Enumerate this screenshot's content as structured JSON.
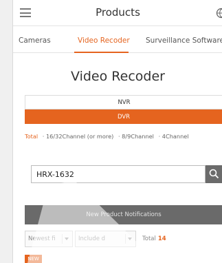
{
  "header": {
    "title": "Products",
    "menu_icon": "menu-icon",
    "globe_icon": "globe-icon"
  },
  "tabs": [
    {
      "label": "Cameras",
      "active": false
    },
    {
      "label": "Video Recoder",
      "active": true
    },
    {
      "label": "Surveillance Software",
      "active": false
    }
  ],
  "section": {
    "title": "Video Recoder"
  },
  "segments": {
    "nvr": "NVR",
    "dvr": "DVR"
  },
  "filters": {
    "total": "Total",
    "options": [
      "16/32Channel (or more)",
      "8/9Channel",
      "4Channel"
    ]
  },
  "search": {
    "value": "HRX-1632",
    "icon": "search-icon"
  },
  "notifications": {
    "label": "New Product Notifications"
  },
  "sort": {
    "selected": "Newest fi"
  },
  "include": {
    "selected": "Include d"
  },
  "results": {
    "total_label": "Total",
    "count": "14"
  },
  "badge": {
    "label": "NEW"
  },
  "colors": {
    "accent": "#e5641f",
    "dark_bar": "#6a6a6a"
  }
}
